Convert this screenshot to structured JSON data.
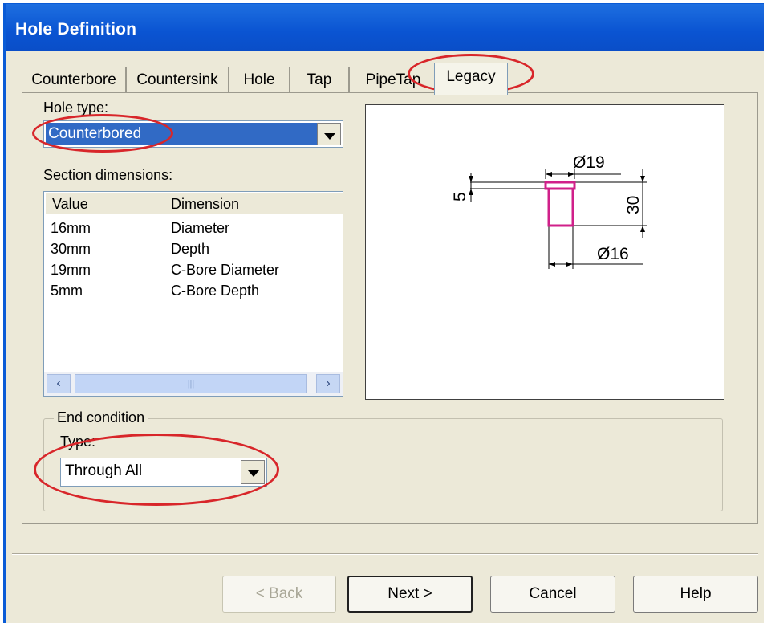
{
  "window": {
    "title": "Hole Definition"
  },
  "tabs": [
    {
      "label": "Counterbore"
    },
    {
      "label": "Countersink"
    },
    {
      "label": "Hole"
    },
    {
      "label": "Tap"
    },
    {
      "label": "PipeTap"
    },
    {
      "label": "Legacy",
      "active": true
    }
  ],
  "hole_type": {
    "label": "Hole type:",
    "value": "Counterbored"
  },
  "section_dimensions": {
    "label": "Section dimensions:",
    "columns": [
      "Value",
      "Dimension"
    ],
    "rows": [
      {
        "value": "16mm",
        "dimension": "Diameter"
      },
      {
        "value": "30mm",
        "dimension": "Depth"
      },
      {
        "value": "19mm",
        "dimension": "C-Bore Diameter"
      },
      {
        "value": "5mm",
        "dimension": "C-Bore Depth"
      }
    ]
  },
  "preview": {
    "dim_cbore_diameter": "Ø19",
    "dim_cbore_depth": "5",
    "dim_depth": "30",
    "dim_diameter": "Ø16"
  },
  "end_condition": {
    "legend": "End condition",
    "type_label": "Type:",
    "value": "Through All"
  },
  "buttons": {
    "back": "< Back",
    "next": "Next >",
    "cancel": "Cancel",
    "help": "Help"
  },
  "colors": {
    "titlebar": "#0A54D2",
    "highlight_ring": "#D8262A",
    "hole_outline": "#D0208A"
  }
}
